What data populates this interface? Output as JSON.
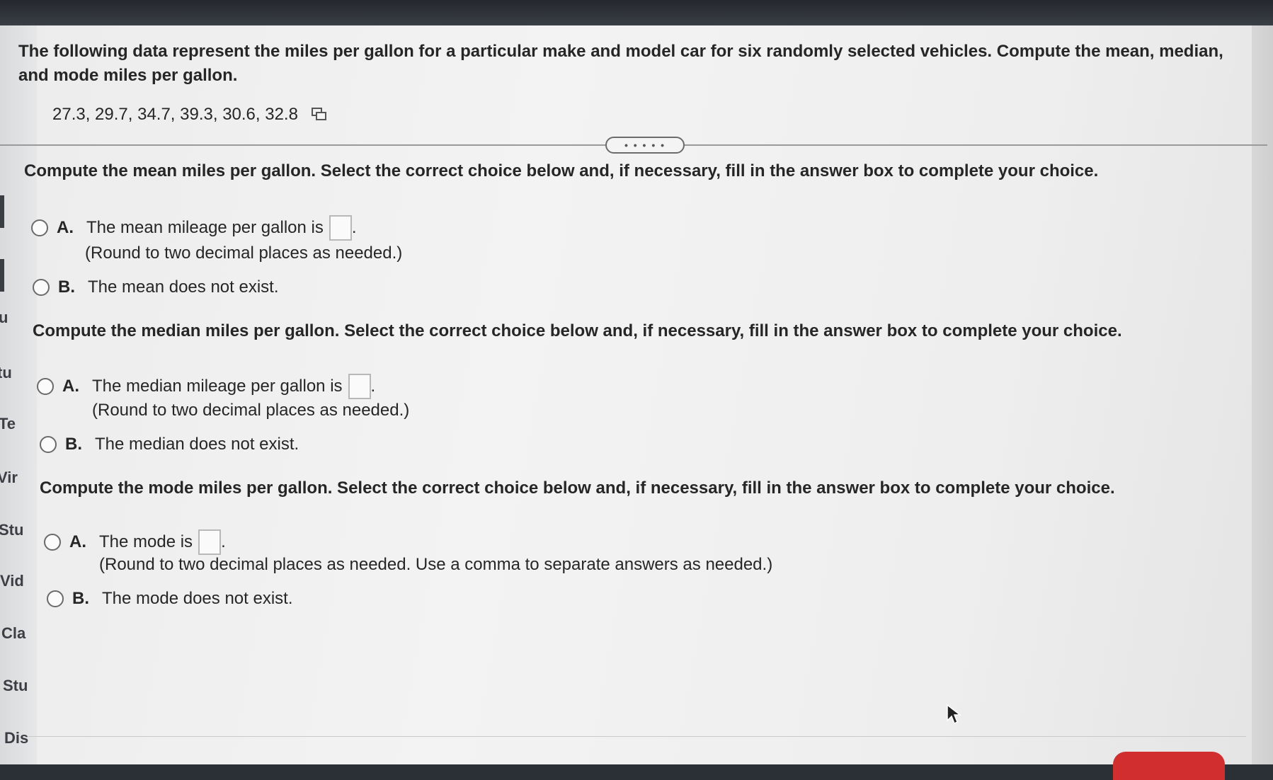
{
  "question": {
    "text": "The following data represent the miles per gallon for a particular make and model car for six randomly selected vehicles. Compute the mean, median, and mode miles per gallon.",
    "data_values": "27.3, 29.7, 34.7, 39.3, 30.6, 32.8"
  },
  "expander_label": "• • • • •",
  "left_tabs": [
    "u",
    "tu",
    "Te",
    "Vir",
    "Stu",
    "Vid",
    "Cla",
    "Stu",
    "Dis"
  ],
  "parts": {
    "mean": {
      "prompt": "Compute the mean miles per gallon. Select the correct choice below and, if necessary, fill in the answer box to complete your choice.",
      "option_a_letter": "A.",
      "option_a_text": "The mean mileage per gallon is",
      "option_a_note": "(Round to two decimal places as needed.)",
      "option_b_letter": "B.",
      "option_b_text": "The mean does not exist."
    },
    "median": {
      "prompt": "Compute the median miles per gallon. Select the correct choice below and, if necessary, fill in the answer box to complete your choice.",
      "option_a_letter": "A.",
      "option_a_text": "The median mileage per gallon is",
      "option_a_note": "(Round to two decimal places as needed.)",
      "option_b_letter": "B.",
      "option_b_text": "The median does not exist."
    },
    "mode": {
      "prompt": "Compute the mode miles per gallon. Select the correct choice below and, if necessary, fill in the answer box to complete your choice.",
      "option_a_letter": "A.",
      "option_a_text": "The mode is",
      "option_a_note": "(Round to two decimal places as needed. Use a comma to separate answers as needed.)",
      "option_b_letter": "B.",
      "option_b_text": "The mode does not exist."
    }
  },
  "colors": {
    "text": "#262626",
    "panel": "#f0f0f0",
    "accent_button": "#d12f2f"
  }
}
